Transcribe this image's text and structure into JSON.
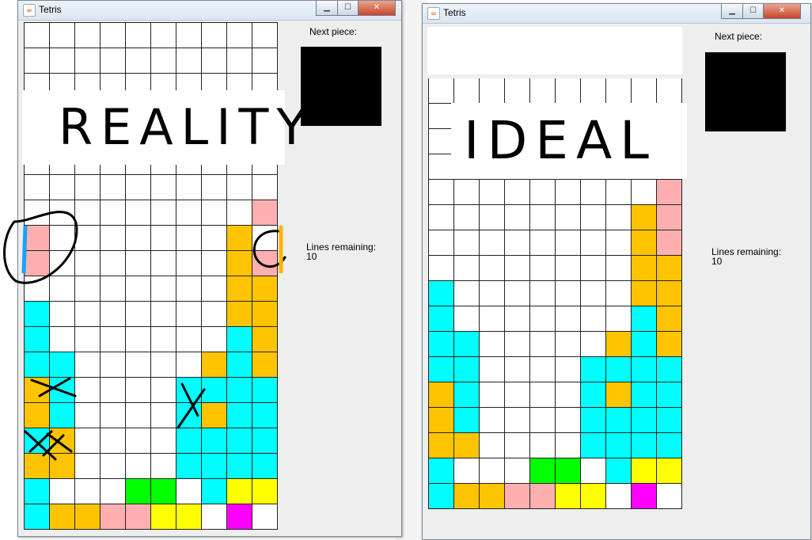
{
  "colors": {
    "empty": "#ffffff",
    "cyan": "#00ffff",
    "orange": "#ffc400",
    "pink": "#ffafaf",
    "green": "#00ff00",
    "yellow": "#ffff00",
    "magenta": "#ff00ff",
    "preview": "#000000"
  },
  "windows": [
    {
      "title": "Tetris",
      "next_piece_label": "Next piece:",
      "lines_label": "Lines remaining:",
      "lines_value": "10",
      "annotation": "REALITY",
      "board": [
        "..........",
        "..........",
        "..........",
        "..........",
        "..........",
        "..........",
        "..........",
        ".........P",
        "P.......O.",
        "P.......OP",
        "........OO",
        "C.......OO",
        "C.......CO",
        "CC.....OCO",
        "OC....CCCC",
        "OC....COCC",
        "CO....CCCC",
        "OO....CCCC",
        "C...GG.CYY",
        "COOPPYY.M."
      ]
    },
    {
      "title": "Tetris",
      "next_piece_label": "Next piece:",
      "lines_label": "Lines remaining:",
      "lines_value": "10",
      "annotation": "IDEAL",
      "board": [
        "..........",
        "..........",
        "..........",
        "..........",
        ".........P",
        "........OP",
        "........OP",
        "........OO",
        "C.......OO",
        "C.......CO",
        "CC.....OCO",
        "CC....CCCC",
        "OC....COCC",
        "OC....CCCC",
        "OO....CCCC",
        "C...GG.CYY",
        "COOPPYY.M."
      ]
    }
  ]
}
